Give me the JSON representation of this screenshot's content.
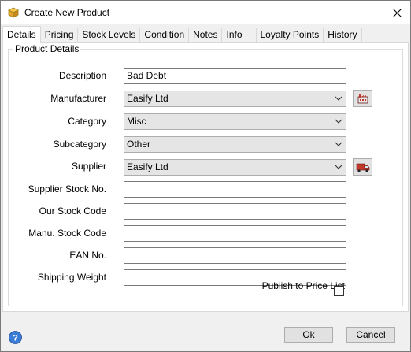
{
  "window": {
    "title": "Create New Product"
  },
  "tabs": [
    "Details",
    "Pricing",
    "Stock Levels",
    "Condition",
    "Notes",
    "Info",
    "Loyalty Points",
    "History"
  ],
  "group": {
    "title": "Product Details"
  },
  "fields": {
    "description": {
      "label": "Description",
      "value": "Bad Debt"
    },
    "manufacturer": {
      "label": "Manufacturer",
      "value": "Easify Ltd"
    },
    "category": {
      "label": "Category",
      "value": "Misc"
    },
    "subcategory": {
      "label": "Subcategory",
      "value": "Other"
    },
    "supplier": {
      "label": "Supplier",
      "value": "Easify Ltd"
    },
    "supplier_stock_no": {
      "label": "Supplier Stock No.",
      "value": ""
    },
    "our_stock_code": {
      "label": "Our Stock Code",
      "value": ""
    },
    "manu_stock_code": {
      "label": "Manu. Stock Code",
      "value": ""
    },
    "ean_no": {
      "label": "EAN No.",
      "value": ""
    },
    "shipping_weight": {
      "label": "Shipping Weight",
      "value": ""
    }
  },
  "publish": {
    "label": "Publish to Price List",
    "checked": false
  },
  "buttons": {
    "ok": "Ok",
    "cancel": "Cancel"
  },
  "icons": {
    "title": "product-box-icon",
    "manufacturer_button": "factory-icon",
    "supplier_button": "delivery-truck-icon",
    "help": "help-icon",
    "close": "close-icon"
  }
}
